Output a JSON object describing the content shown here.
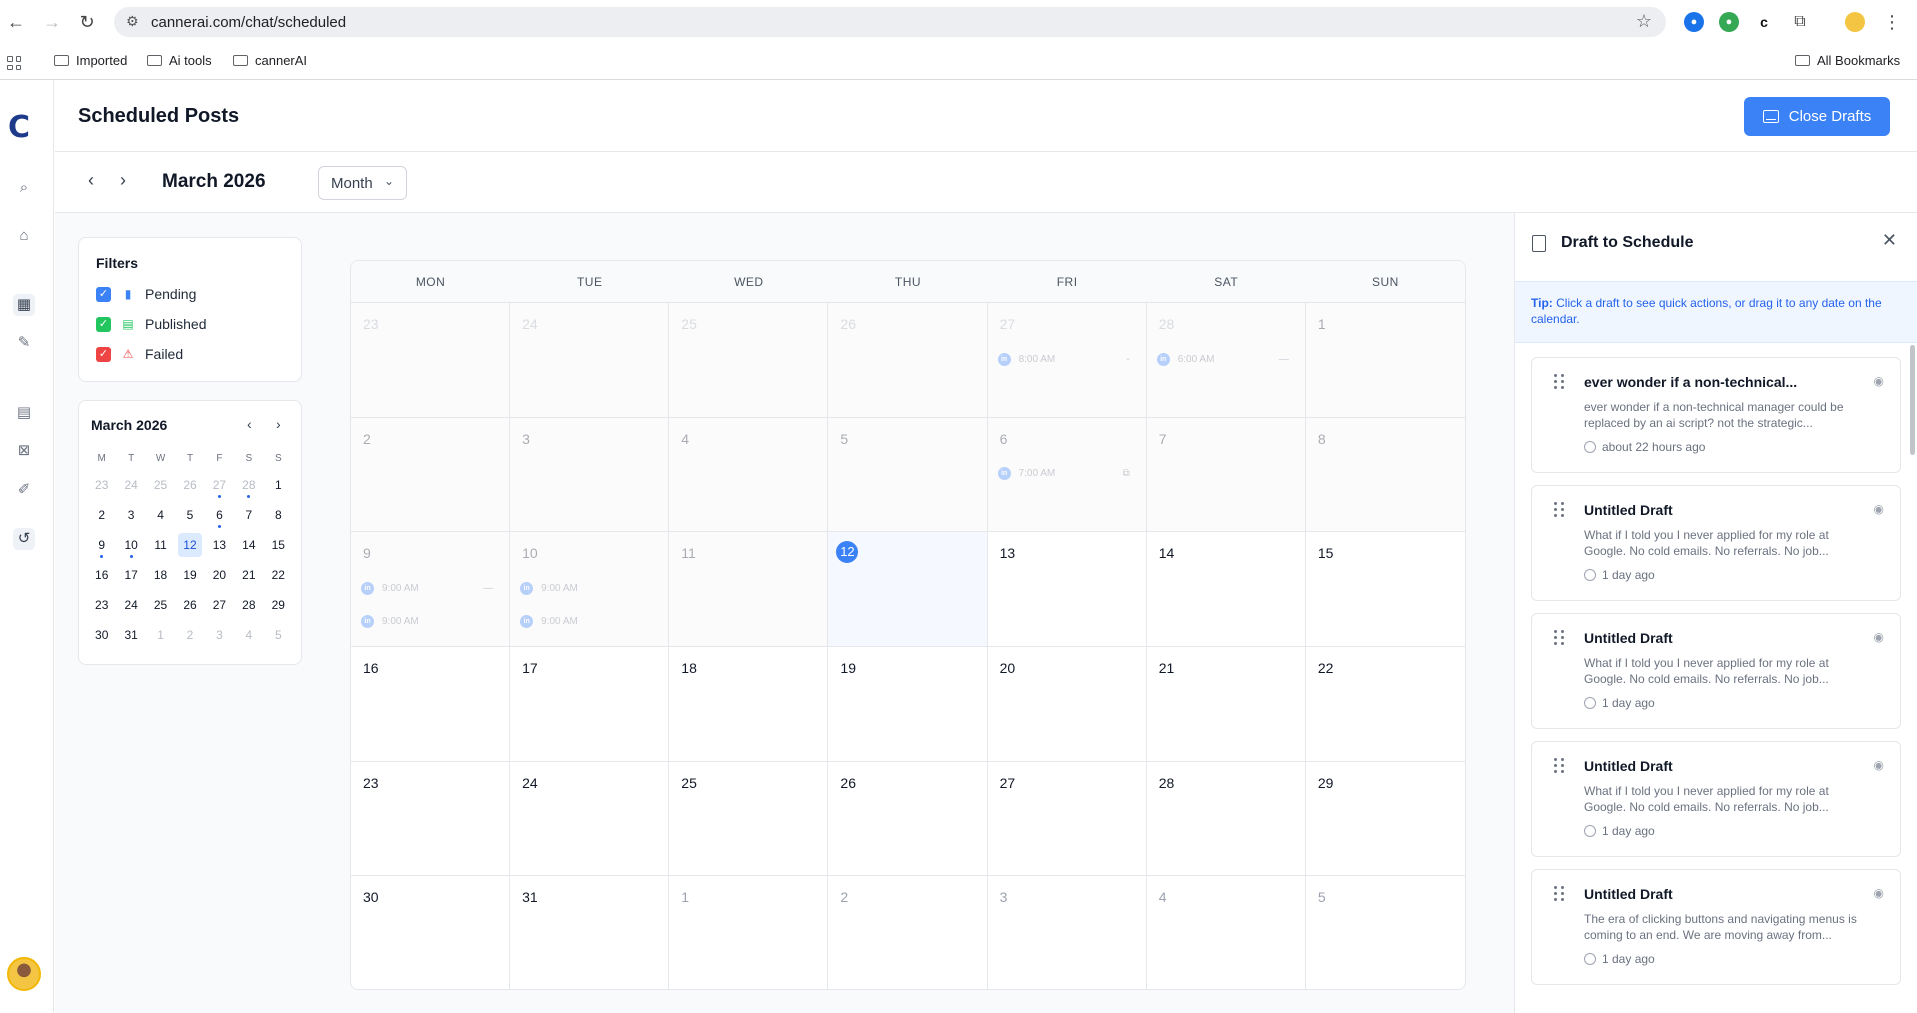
{
  "browser": {
    "url": "cannerai.com/chat/scheduled",
    "bookmarks": [
      "Imported",
      "Ai tools",
      "cannerAI"
    ],
    "all_bookmarks": "All Bookmarks"
  },
  "app": {
    "logo": "C",
    "page_title": "Scheduled Posts",
    "close_drafts_label": "Close Drafts"
  },
  "toolbar": {
    "month_label": "March 2026",
    "view_selected": "Month"
  },
  "filters": {
    "title": "Filters",
    "items": [
      {
        "label": "Pending",
        "color": "#3b82f6"
      },
      {
        "label": "Published",
        "color": "#22c55e"
      },
      {
        "label": "Failed",
        "color": "#ef4444"
      }
    ]
  },
  "mini_calendar": {
    "title": "March 2026",
    "weekdays": [
      "M",
      "T",
      "W",
      "T",
      "F",
      "S",
      "S"
    ],
    "weeks": [
      [
        "23",
        "24",
        "25",
        "26",
        "27",
        "28",
        "1"
      ],
      [
        "2",
        "3",
        "4",
        "5",
        "6",
        "7",
        "8"
      ],
      [
        "9",
        "10",
        "11",
        "12",
        "13",
        "14",
        "15"
      ],
      [
        "16",
        "17",
        "18",
        "19",
        "20",
        "21",
        "22"
      ],
      [
        "23",
        "24",
        "25",
        "26",
        "27",
        "28",
        "29"
      ],
      [
        "30",
        "31",
        "1",
        "2",
        "3",
        "4",
        "5"
      ]
    ]
  },
  "calendar": {
    "weekdays": [
      "MON",
      "TUE",
      "WED",
      "THU",
      "FRI",
      "SAT",
      "SUN"
    ],
    "weeks": [
      [
        "23",
        "24",
        "25",
        "26",
        "27",
        "28",
        "1"
      ],
      [
        "2",
        "3",
        "4",
        "5",
        "6",
        "7",
        "8"
      ],
      [
        "9",
        "10",
        "11",
        "12",
        "13",
        "14",
        "15"
      ],
      [
        "16",
        "17",
        "18",
        "19",
        "20",
        "21",
        "22"
      ],
      [
        "23",
        "24",
        "25",
        "26",
        "27",
        "28",
        "29"
      ],
      [
        "30",
        "31",
        "1",
        "2",
        "3",
        "4",
        "5"
      ]
    ],
    "posts": {
      "w0d4": [
        "8:00 AM"
      ],
      "w0d5": [
        "6:00 AM"
      ],
      "w1d4": [
        "7:00 AM"
      ],
      "w2d0": [
        "9:00 AM",
        "9:00 AM"
      ],
      "w2d1": [
        "9:00 AM",
        "9:00 AM"
      ]
    }
  },
  "draft_panel": {
    "title": "Draft to Schedule",
    "tip_label": "Tip:",
    "tip_text": "Click a draft to see quick actions, or drag it to any date on the calendar.",
    "drafts": [
      {
        "title": "ever wonder if a non-technical...",
        "snippet": "ever wonder if a non-technical manager could be replaced by an ai script? not the strategic...",
        "time": "about 22 hours ago"
      },
      {
        "title": "Untitled Draft",
        "snippet": "What if I told you I never applied for my role at Google. No cold emails. No referrals. No job...",
        "time": "1 day ago"
      },
      {
        "title": "Untitled Draft",
        "snippet": "What if I told you I never applied for my role at Google. No cold emails. No referrals. No job...",
        "time": "1 day ago"
      },
      {
        "title": "Untitled Draft",
        "snippet": "What if I told you I never applied for my role at Google. No cold emails. No referrals. No job...",
        "time": "1 day ago"
      },
      {
        "title": "Untitled Draft",
        "snippet": "The era of clicking buttons and navigating menus is coming to an end. We are moving away from...",
        "time": "1 day ago"
      }
    ]
  }
}
